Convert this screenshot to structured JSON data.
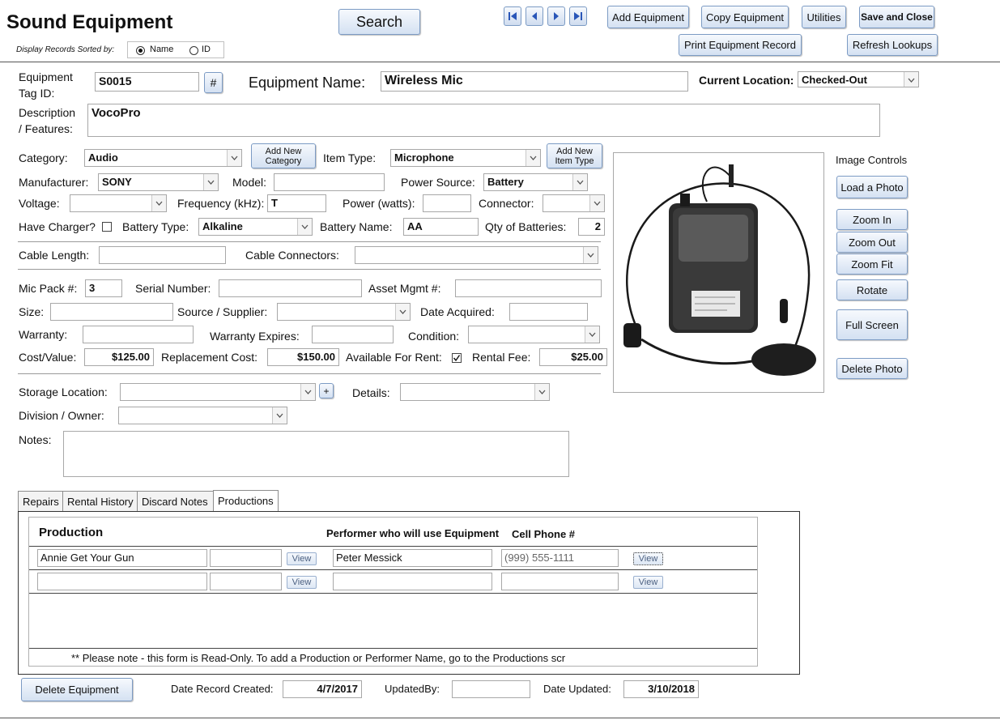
{
  "header": {
    "title": "Sound Equipment",
    "sort_label": "Display Records Sorted by:",
    "sort_options": [
      "Name",
      "ID"
    ],
    "sort_selected": "Name",
    "search_label": "Search",
    "buttons": {
      "add_equipment": "Add Equipment",
      "copy_equipment": "Copy Equipment",
      "utilities": "Utilities",
      "save_close": "Save and Close",
      "print_record": "Print Equipment Record",
      "refresh_lookups": "Refresh Lookups"
    }
  },
  "record": {
    "tag_label_1": "Equipment",
    "tag_label_2": "Tag ID:",
    "tag_id": "S0015",
    "hash_label": "#",
    "name_label": "Equipment Name:",
    "name": "Wireless Mic",
    "location_label": "Current Location:",
    "location": "Checked-Out",
    "desc_label_1": "Description",
    "desc_label_2": "/ Features:",
    "description": "VocoPro",
    "category_label": "Category:",
    "category": "Audio",
    "add_category_1": "Add New",
    "add_category_2": "Category",
    "item_type_label": "Item Type:",
    "item_type": "Microphone",
    "add_item_type_1": "Add New",
    "add_item_type_2": "Item Type",
    "manufacturer_label": "Manufacturer:",
    "manufacturer": "SONY",
    "model_label": "Model:",
    "model": "",
    "power_source_label": "Power Source:",
    "power_source": "Battery",
    "voltage_label": "Voltage:",
    "voltage": "",
    "frequency_label": "Frequency (kHz):",
    "frequency": "T",
    "power_label": "Power (watts):",
    "power": "",
    "connector_label": "Connector:",
    "connector": "",
    "charger_label": "Have Charger?",
    "battery_type_label": "Battery Type:",
    "battery_type": "Alkaline",
    "battery_name_label": "Battery Name:",
    "battery_name": "AA",
    "qty_batteries_label": "Qty of Batteries:",
    "qty_batteries": "2",
    "cable_length_label": "Cable Length:",
    "cable_length": "",
    "cable_connectors_label": "Cable Connectors:",
    "cable_connectors": "",
    "mic_pack_label": "Mic Pack #:",
    "mic_pack": "3",
    "serial_label": "Serial Number:",
    "serial": "",
    "asset_label": "Asset Mgmt #:",
    "asset": "",
    "size_label": "Size:",
    "size": "",
    "source_label": "Source / Supplier:",
    "source": "",
    "date_acquired_label": "Date Acquired:",
    "date_acquired": "",
    "warranty_label": "Warranty:",
    "warranty": "",
    "warranty_expires_label": "Warranty Expires:",
    "warranty_expires": "",
    "condition_label": "Condition:",
    "condition": "",
    "cost_label": "Cost/Value:",
    "cost": "$125.00",
    "replacement_label": "Replacement Cost:",
    "replacement": "$150.00",
    "available_label": "Available For Rent:",
    "rental_fee_label": "Rental Fee:",
    "rental_fee": "$25.00",
    "storage_label": "Storage Location:",
    "storage": "",
    "plus_label": "+",
    "details_label": "Details:",
    "details": "",
    "division_label": "Division / Owner:",
    "division": "",
    "notes_label": "Notes:",
    "notes": ""
  },
  "image_controls": {
    "title": "Image Controls",
    "load": "Load a Photo",
    "zoom_in": "Zoom In",
    "zoom_out": "Zoom Out",
    "zoom_fit": "Zoom Fit",
    "rotate": "Rotate",
    "full_screen": "Full Screen",
    "delete": "Delete Photo"
  },
  "tabs": [
    "Repairs",
    "Rental History",
    "Discard Notes",
    "Productions"
  ],
  "productions": {
    "col_production": "Production",
    "col_performer": "Performer who will use Equipment",
    "col_phone": "Cell Phone #",
    "view_label": "View",
    "rows": [
      {
        "production": "Annie Get Your Gun",
        "extra": "",
        "performer": "Peter Messick",
        "phone": "(999) 555-1111"
      },
      {
        "production": "",
        "extra": "",
        "performer": "",
        "phone": ""
      }
    ],
    "note": "** Please note - this form is Read-Only.  To add a Production or Performer Name, go to the Productions scr"
  },
  "footer": {
    "delete_equipment": "Delete Equipment",
    "created_label": "Date Record Created:",
    "created": "4/7/2017",
    "updated_by_label": "UpdatedBy:",
    "updated_by": "",
    "updated_label": "Date Updated:",
    "updated": "3/10/2018"
  }
}
